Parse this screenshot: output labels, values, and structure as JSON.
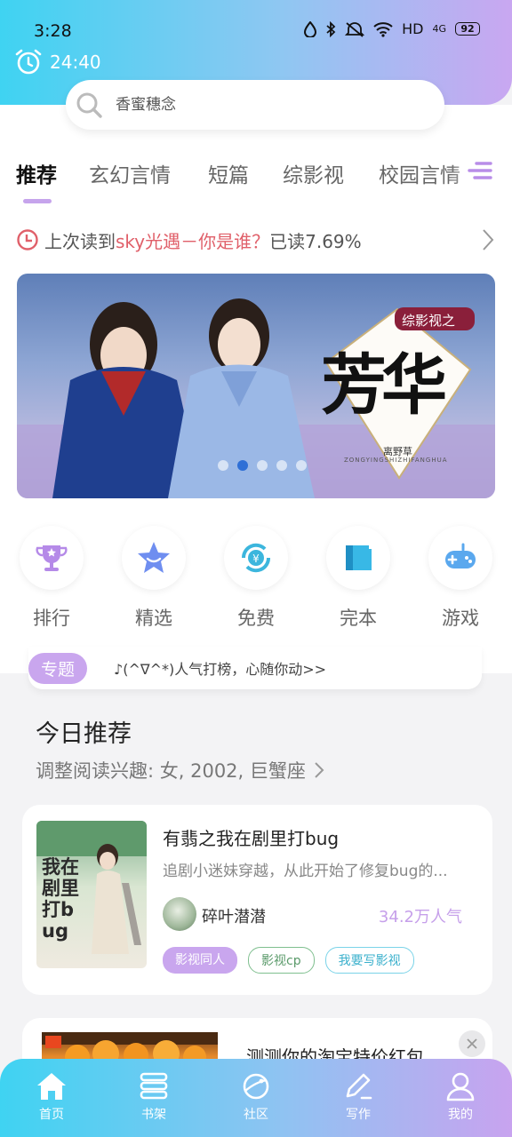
{
  "status_bar": {
    "time": "3:28",
    "network": "HD",
    "signal_type": "4G",
    "battery": "92"
  },
  "alarm": {
    "time": "24:40"
  },
  "search": {
    "placeholder": "香蜜穗念"
  },
  "tabs": [
    {
      "label": "推荐",
      "active": true
    },
    {
      "label": "玄幻言情",
      "active": false
    },
    {
      "label": "短篇",
      "active": false
    },
    {
      "label": "综影视",
      "active": false
    },
    {
      "label": "校园言情",
      "active": false
    }
  ],
  "last_read": {
    "prefix": "上次读到",
    "title": "sky光遇－你是谁？",
    "progress_text": "已读7.69%"
  },
  "banner": {
    "dots_count": 5,
    "active_dot": 2,
    "slide_texts": [
      "综影视之",
      "芳华",
      "离野草",
      "ZONGYINGSHIZHIFANGHUA"
    ]
  },
  "quick_links": [
    {
      "label": "排行",
      "icon": "trophy-icon",
      "color": "#b58ae8"
    },
    {
      "label": "精选",
      "icon": "star-icon",
      "color": "#6f8ef0"
    },
    {
      "label": "免费",
      "icon": "yuan-icon",
      "color": "#3cb6dd"
    },
    {
      "label": "完本",
      "icon": "book-icon",
      "color": "#38b8e6"
    },
    {
      "label": "游戏",
      "icon": "gamepad-icon",
      "color": "#5aa8ee"
    }
  ],
  "topic": {
    "badge": "专题",
    "text": "♪(^∇^*)人气打榜，心随你动>>"
  },
  "today": {
    "title": "今日推荐",
    "subtitle": "调整阅读兴趣: 女, 2002, 巨蟹座"
  },
  "book": {
    "title": "有翡之我在剧里打bug",
    "description": "追剧小迷妹穿越，从此开始了修复bug的...",
    "author": "碎叶潜潜",
    "popularity": "34.2万人气",
    "cover_text": "我在剧里打bug",
    "tags": [
      "影视同人",
      "影视cp",
      "我要写影视"
    ]
  },
  "ad": {
    "title": "测测你的淘宝特价红包..."
  },
  "bottom_nav": [
    {
      "label": "首页",
      "icon": "home-icon",
      "active": true
    },
    {
      "label": "书架",
      "icon": "bookshelf-icon",
      "active": false
    },
    {
      "label": "社区",
      "icon": "planet-icon",
      "active": false
    },
    {
      "label": "写作",
      "icon": "pen-icon",
      "active": false
    },
    {
      "label": "我的",
      "icon": "user-icon",
      "active": false
    }
  ],
  "colors": {
    "accent": "#c6a4ec",
    "header_start": "#3fd3f2",
    "header_end": "#c9a7f1",
    "highlight": "#e0606a",
    "popularity": "#c6a0ea"
  }
}
